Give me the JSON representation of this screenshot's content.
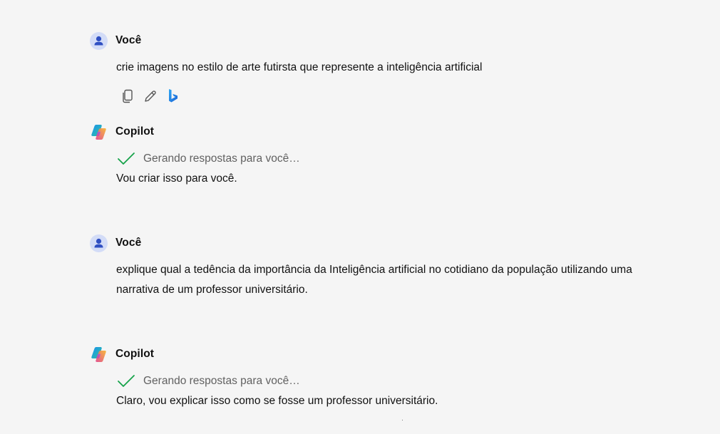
{
  "messages": [
    {
      "author": "Você",
      "text": "crie imagens no estilo de arte futirsta que represente a inteligência artificial"
    },
    {
      "author": "Copilot",
      "status": "Gerando respostas para você…",
      "text": "Vou criar isso para você."
    },
    {
      "author": "Você",
      "text": "explique qual a tedência da importância da Inteligência artificial no cotidiano da população utilizando uma narrativa de um professor universitário."
    },
    {
      "author": "Copilot",
      "status": "Gerando respostas para você…",
      "text": "Claro, vou explicar isso como se fosse um professor universitário."
    }
  ],
  "message_actions": [
    "copy-icon",
    "edit-icon",
    "bing-icon"
  ],
  "colors": {
    "background": "#f5f5f5",
    "user_avatar_bg": "#d3dcf7",
    "user_avatar_fg": "#2f4fc2",
    "check": "#16a34a",
    "status_text": "#616161"
  }
}
